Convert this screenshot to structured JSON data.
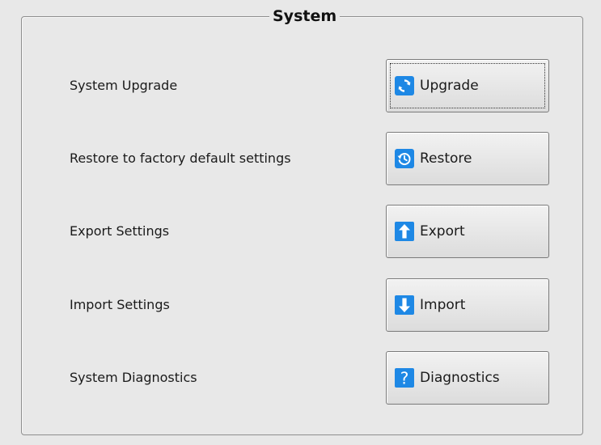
{
  "group": {
    "title": "System"
  },
  "rows": [
    {
      "label": "System Upgrade",
      "button": {
        "label": "Upgrade",
        "icon": "refresh-icon",
        "focused": true
      }
    },
    {
      "label": "Restore to factory default settings",
      "button": {
        "label": "Restore",
        "icon": "restore-clock-icon",
        "focused": false
      }
    },
    {
      "label": "Export Settings",
      "button": {
        "label": "Export",
        "icon": "upload-arrow-icon",
        "focused": false
      }
    },
    {
      "label": "Import Settings",
      "button": {
        "label": "Import",
        "icon": "download-arrow-icon",
        "focused": false
      }
    },
    {
      "label": "System Diagnostics",
      "button": {
        "label": "Diagnostics",
        "icon": "question-mark-icon",
        "focused": false
      }
    }
  ],
  "colors": {
    "icon_blue": "#1e88e5",
    "background": "#e8e8e8"
  }
}
